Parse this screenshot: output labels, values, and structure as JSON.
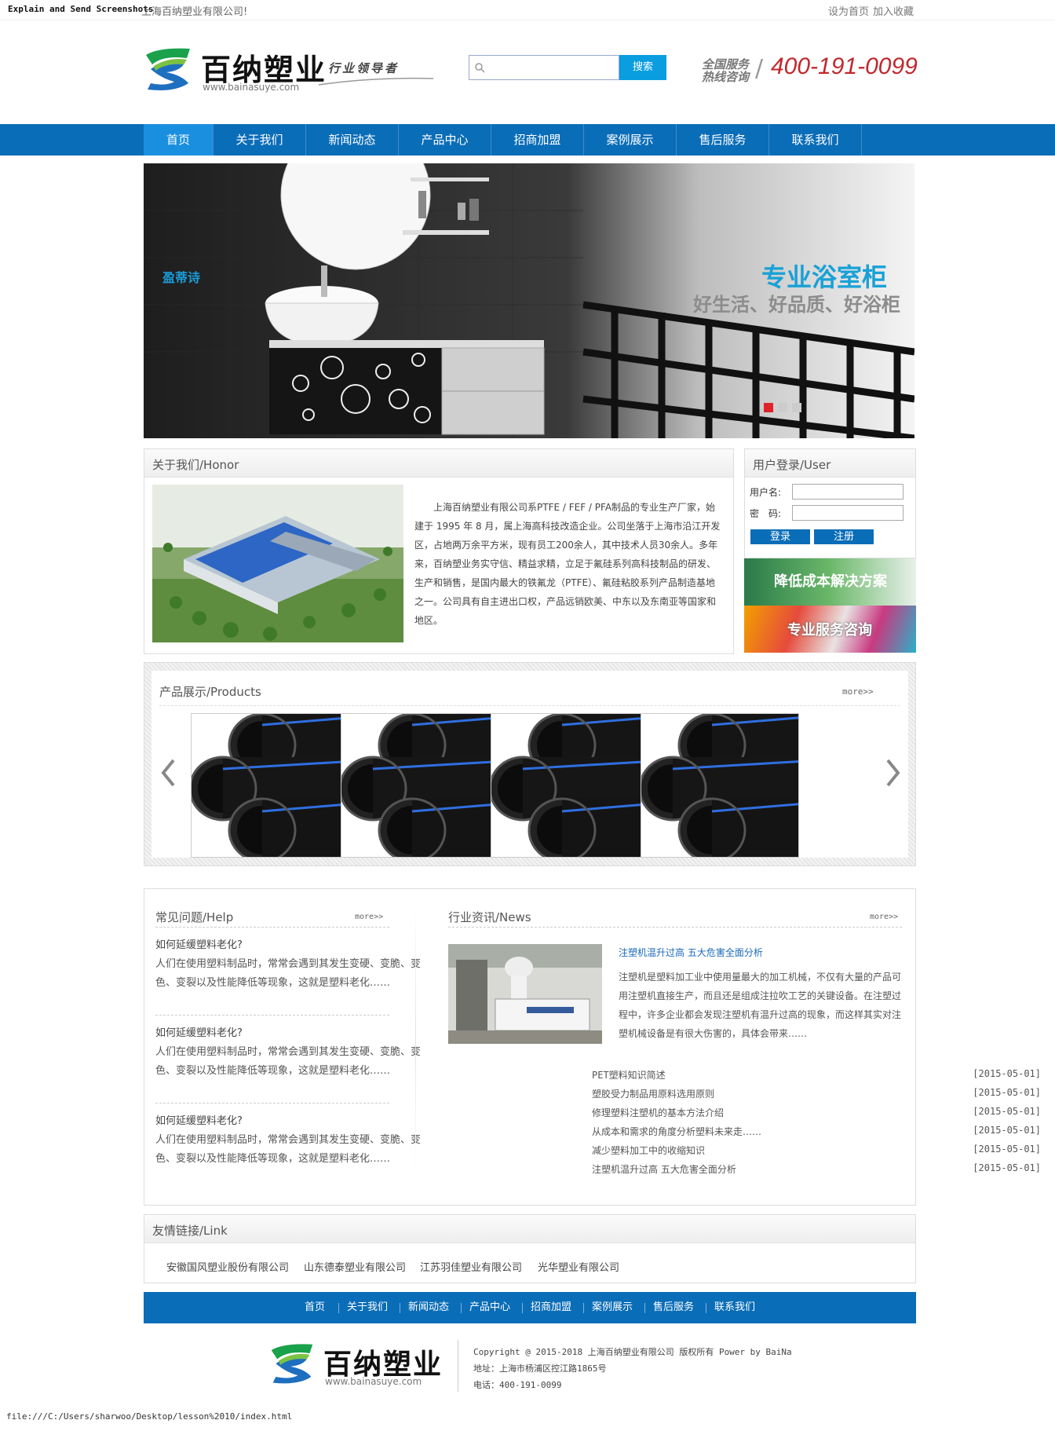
{
  "browser": {
    "doc_title": "Explain and Send Screenshots",
    "status_url": "file:///C:/Users/sharwoo/Desktop/lesson%2010/index.html"
  },
  "topbar": {
    "welcome": "上海百纳塑业有限公司!",
    "set_home": "设为首页",
    "bookmark": "加入收藏"
  },
  "header": {
    "logo_text": "百纳塑业",
    "logo_url": "www.bainasuye.com",
    "slogan": "行业领导者",
    "search_placeholder": "",
    "search_button": "搜索",
    "hotline_1": "全国服务",
    "hotline_2": "热线咨询",
    "phone": "400-191-0099"
  },
  "nav": [
    "首页",
    "关于我们",
    "新闻动态",
    "产品中心",
    "招商加盟",
    "案例展示",
    "售后服务",
    "联系我们"
  ],
  "banner": {
    "brand": "盈蒂诗",
    "headline": "专业浴室柜",
    "subline": "好生活、好品质、好浴柜"
  },
  "about": {
    "title": "关于我们/Honor",
    "text": "上海百纳塑业有限公司系PTFE / FEF / PFA制品的专业生产厂家，始建于 1995 年 8 月，属上海高科技改造企业。公司坐落于上海市沿江开发区，占地两万余平方米，现有员工200余人，其中技术人员30余人。多年来，百纳塑业务实守信、精益求精，立足于氟硅系列高科技制品的研发、生产和销售，是国内最大的铁氟龙（PTFE）、氟硅粘胶系列产品制造基地之一。公司具有自主进出口权，产品远销欧美、中东以及东南亚等国家和地区。"
  },
  "login": {
    "title": "用户登录/User",
    "username_label": "用户名:",
    "password_label": "密　码:",
    "login_button": "登录",
    "register_button": "注册"
  },
  "promos": {
    "first": "降低成本解决方案",
    "second": "专业服务咨询"
  },
  "products": {
    "title": "产品展示/Products",
    "more": "more>>"
  },
  "help": {
    "title": "常见问题/Help",
    "more": "more>>",
    "items": [
      {
        "q": "如何延缓塑料老化?",
        "a1": "人们在使用塑料制品时，常常会遇到其发生变硬、变脆、变",
        "a2": "色、变裂以及性能降低等现象，这就是塑料老化……"
      },
      {
        "q": "如何延缓塑料老化?",
        "a1": "人们在使用塑料制品时，常常会遇到其发生变硬、变脆、变",
        "a2": "色、变裂以及性能降低等现象，这就是塑料老化……"
      },
      {
        "q": "如何延缓塑料老化?",
        "a1": "人们在使用塑料制品时，常常会遇到其发生变硬、变脆、变",
        "a2": "色、变裂以及性能降低等现象，这就是塑料老化……"
      }
    ]
  },
  "news": {
    "title": "行业资讯/News",
    "more": "more>>",
    "featured_title": "注塑机温升过高 五大危害全面分析",
    "featured_text": "注塑机是塑料加工业中使用量最大的加工机械，不仅有大量的产品可用注塑机直接生产，而且还是组成注拉吹工艺的关键设备。在注塑过程中，许多企业都会发现注塑机有温升过高的现象，而这样其实对注塑机械设备是有很大伤害的，具体会带来……",
    "list": [
      {
        "title": "PET塑料知识简述",
        "date": "[2015-05-01]"
      },
      {
        "title": "塑胶受力制品用原料选用原则",
        "date": "[2015-05-01]"
      },
      {
        "title": "修理塑料注塑机的基本方法介绍",
        "date": "[2015-05-01]"
      },
      {
        "title": "从成本和需求的角度分析塑料未来走……",
        "date": "[2015-05-01]"
      },
      {
        "title": "减少塑料加工中的收缩知识",
        "date": "[2015-05-01]"
      },
      {
        "title": "注塑机温升过高 五大危害全面分析",
        "date": "[2015-05-01]"
      }
    ]
  },
  "links": {
    "title": "友情链接/Link",
    "items": [
      "安徽国风塑业股份有限公司",
      "山东德泰塑业有限公司",
      "江苏羽佳塑业有限公司",
      "光华塑业有限公司"
    ]
  },
  "footer": {
    "nav": [
      "首页",
      "关于我们",
      "新闻动态",
      "产品中心",
      "招商加盟",
      "案例展示",
      "售后服务",
      "联系我们"
    ],
    "logo_text": "百纳塑业",
    "logo_url": "www.bainasuye.com",
    "copyright": "Copyright @ 2015-2018 上海百纳塑业有限公司 版权所有 Power by BaiNa",
    "address": "地址：上海市杨浦区控江路1865号",
    "phone": "电话：400-191-0099"
  },
  "colors": {
    "nav_blue": "#0a6db8",
    "active_blue": "#1a8fe0",
    "phone_red": "#c0282d"
  }
}
